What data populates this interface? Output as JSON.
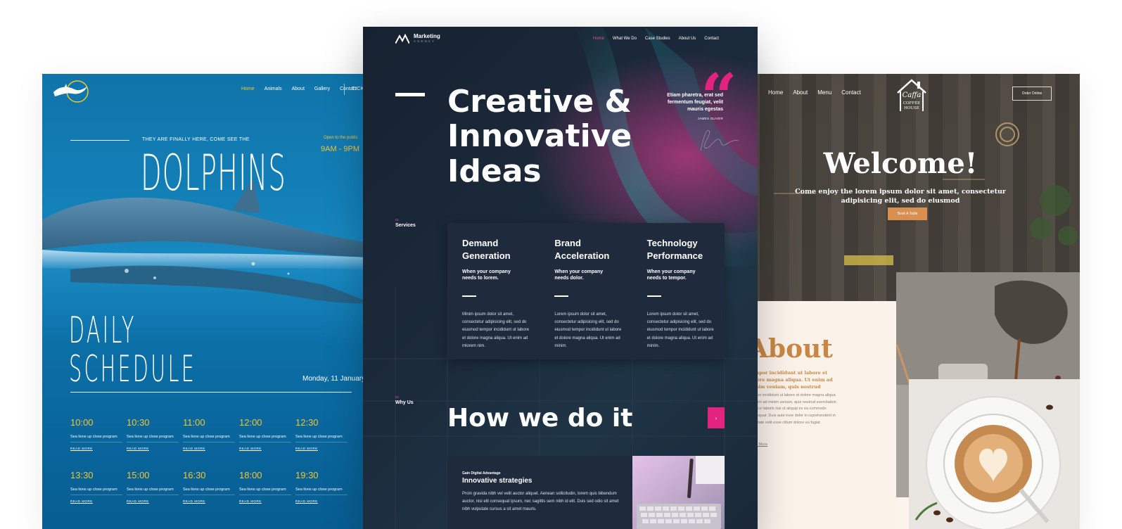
{
  "left": {
    "nav": [
      "Home",
      "Animals",
      "About",
      "Gallery",
      "Contact"
    ],
    "nav_active": "Home",
    "ticket": "TICKE",
    "tagline": "THEY ARE FINALLY HERE, COME SEE THE",
    "open_label": "Open to the public",
    "hours": "9AM - 9PM",
    "title": "DOLPHINS",
    "schedule_title_1": "DAILY",
    "schedule_title_2": "SCHEDULE",
    "date": "Monday, 11 January",
    "slots": [
      {
        "time": "10:00",
        "desc": "Sea lions up close program",
        "more": "READ MORE"
      },
      {
        "time": "10:30",
        "desc": "Sea lions up close program",
        "more": "READ MORE"
      },
      {
        "time": "11:00",
        "desc": "Sea lions up close program",
        "more": "READ MORE"
      },
      {
        "time": "12:00",
        "desc": "Sea lions up close program",
        "more": "READ MORE"
      },
      {
        "time": "12:30",
        "desc": "Sea lions up close program",
        "more": "READ MORE"
      },
      {
        "time": "13:30",
        "desc": "Sea lions up close program",
        "more": "READ MORE"
      },
      {
        "time": "15:00",
        "desc": "Sea lions up close program",
        "more": "READ MORE"
      },
      {
        "time": "16:30",
        "desc": "Sea lions up close program",
        "more": "READ MORE"
      },
      {
        "time": "18:00",
        "desc": "Sea lions up close program",
        "more": "READ MORE"
      },
      {
        "time": "19:30",
        "desc": "Sea lions up close program",
        "more": "READ MORE"
      }
    ],
    "colors": {
      "accent": "#f3c431",
      "bg": "#0f74aa"
    }
  },
  "center": {
    "brand": "Marketing",
    "brand_sub": "AGENCY",
    "nav": [
      "Home",
      "What We Do",
      "Case Studies",
      "About Us",
      "Contact"
    ],
    "nav_active": "Home",
    "headline_1": "Creative &",
    "headline_2": "Innovative",
    "headline_3": "Ideas",
    "quote": "Etiam pharetra, erat sed fermentum feugiat, velit mauris egestas",
    "author": "JAMES OLIVER",
    "services_num": "01",
    "services_label": "Services",
    "services": [
      {
        "title_1": "Demand",
        "title_2": "Generation",
        "sub_1": "When your company",
        "sub_2": "needs to lorem.",
        "body": "Minim ipsum dolor sit amet, consectetur adipisicing elit, sed do eiusmod tempor incididunt ut labore et dolore magna aliqua. Ut enim ad mlorem nim."
      },
      {
        "title_1": "Brand",
        "title_2": "Acceleration",
        "sub_1": "When your company",
        "sub_2": "needs dolor.",
        "body": "Lorem ipsum dolor sit amet, consectetur adipisicing elit, sed do eiusmod tempor incididunt ut labore et dolore magna aliqua. Ut enim ad minim."
      },
      {
        "title_1": "Technology",
        "title_2": "Performance",
        "sub_1": "When your company",
        "sub_2": "needs to tempor.",
        "body": "Lorem ipsum dolor sit amet, consectetur adipisicing elit, sed do eiusmod tempor incididunt ut labore et dolore magna aliqua. Ut enim ad minim."
      }
    ],
    "why_num": "02",
    "why_label": "Why Us",
    "how_title": "How we do it",
    "next_icon": "chevron-right-icon",
    "strategy_eyebrow": "Gain Digital Advantage",
    "strategy_title": "Innovative strategies",
    "strategy_body": "Proin gravida nibh vel velit auctor aliquet. Aenean sollicitudin, lorem quis bibendum auctor, nisi elit consequat ipsum, nec sagittis sem nibh id elit. Duis sed odio sit amet nibh vulputate cursus a sit amet mauris.",
    "colors": {
      "accent": "#e2247f",
      "bg": "#172231"
    }
  },
  "right": {
    "nav": [
      "Home",
      "About",
      "Menu",
      "Contact"
    ],
    "logo_script": "Caffa",
    "logo_text_1": "COFFEE",
    "logo_text_2": "HOUSE",
    "order_btn": "Order Online",
    "welcome": "Welcome!",
    "welcome_sub": "Come enjoy the lorem ipsum dolor sit amet, consectetur adipisicing elit, sed do eiusmod",
    "book_btn": "Book A Table",
    "about_title": "About",
    "about_lead": "Tempor incididunt ut labore et dolore magna aliqua. Ut enim ad minim veniam, quis nostrud",
    "about_body": "Tempor incididunt ut labore et dolore magna aliqua. Ut enim ad minim veniam, quis nostrud exercitation ullamco laboris nisi ut aliquip ex ea commodo consequat. Duis aute irure dolor in reprehenderit in voluptate velit esse cillum dolore eu fugiat",
    "about_link": "Read More",
    "colors": {
      "accent": "#c88744",
      "button": "#d88f4f"
    }
  }
}
